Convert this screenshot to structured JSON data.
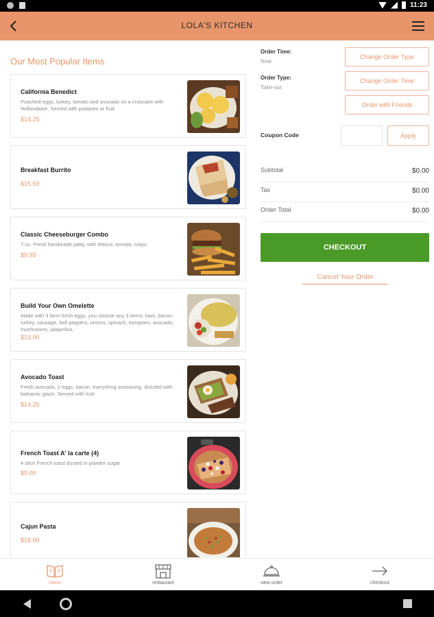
{
  "status_bar": {
    "time": "11:23"
  },
  "app_bar": {
    "title": "LOLA'S KITCHEN"
  },
  "menu": {
    "section_title": "Our Most Popular Items",
    "items": [
      {
        "name": "California Benedict",
        "description": "Poached eggs, turkey, tomato and avocado on a croissant with Hollandaise. Served with potatoes or fruit",
        "price": "$14.25",
        "image": "benedict-photo"
      },
      {
        "name": "Breakfast Burrito",
        "description": "",
        "price": "$15.50",
        "image": "burrito-photo"
      },
      {
        "name": "Classic Cheeseburger Combo",
        "description": "7 oz. Fresh handmade patty, with lettuce, tomato, mayo",
        "price": "$9.99",
        "image": "cheeseburger-photo"
      },
      {
        "name": "Build Your Own Omelette",
        "description": "Made with 3 farm fresh eggs, you choose any 3 items: ham, bacon, turkey, sausage, bell peppers, onions, spinach, tomatoes, avocado, mushrooms, jalapeños,",
        "price": "$13.00",
        "image": "omelette-photo"
      },
      {
        "name": "Avocado Toast",
        "description": "Fresh avocado, 2 eggs, bacon, everything seasoning, drizzled with balsamic glaze. Served with fruit",
        "price": "$14.25",
        "image": "avocado-toast-photo"
      },
      {
        "name": "French Toast A' la carte (4)",
        "description": "4 slice French toast dusted in powder sugar",
        "price": "$9.00",
        "image": "french-toast-photo"
      },
      {
        "name": "Cajun Pasta",
        "description": "",
        "price": "$18.00",
        "image": "cajun-pasta-photo"
      }
    ]
  },
  "order_panel": {
    "order_time_label": "Order Time:",
    "order_time_value": "Now",
    "order_type_label": "Order Type:",
    "order_type_value": "Take-out",
    "change_type_button": "Change Order Type",
    "change_time_button": "Change Order Time",
    "order_friends_button": "Order with Friends",
    "coupon_label": "Coupon Code",
    "coupon_placeholder": "",
    "apply_button": "Apply",
    "subtotal_label": "Subtotal",
    "subtotal_value": "$0.00",
    "tax_label": "Tax",
    "tax_value": "$0.00",
    "total_label": "Order Total",
    "total_value": "$0.00",
    "checkout_button": "CHECKOUT",
    "cancel_link": "Cancel Your Order"
  },
  "bottom_nav": {
    "items": [
      {
        "label": "menu",
        "icon": "menu-book-icon",
        "active": true
      },
      {
        "label": "restaurant",
        "icon": "storefront-icon",
        "active": false
      },
      {
        "label": "view order",
        "icon": "cloche-icon",
        "active": false
      },
      {
        "label": "checkout",
        "icon": "arrow-right-icon",
        "active": false
      }
    ]
  },
  "colors": {
    "accent": "#e8956b",
    "checkout": "#4a9a28",
    "status_bar": "#000000"
  }
}
